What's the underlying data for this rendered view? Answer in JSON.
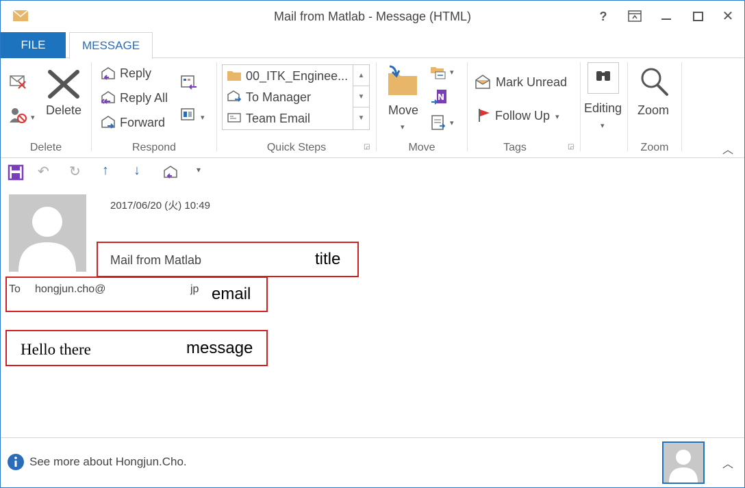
{
  "window": {
    "title": "Mail from Matlab - Message (HTML)"
  },
  "titlebar": {
    "help": "?",
    "close": "✕"
  },
  "tabs": {
    "file": "FILE",
    "message": "MESSAGE"
  },
  "ribbon": {
    "delete_group": {
      "label": "Delete",
      "delete_button": "Delete"
    },
    "respond_group": {
      "label": "Respond",
      "reply": "Reply",
      "reply_all": "Reply All",
      "forward": "Forward"
    },
    "quick_steps": {
      "label": "Quick Steps",
      "items": [
        "00_ITK_Enginee...",
        "To Manager",
        "Team Email"
      ]
    },
    "move_group": {
      "label": "Move",
      "move_button": "Move"
    },
    "tags_group": {
      "label": "Tags",
      "mark_unread": "Mark Unread",
      "follow_up": "Follow Up"
    },
    "editing": {
      "label": "Editing"
    },
    "zoom_group": {
      "label": "Zoom",
      "zoom_button": "Zoom"
    }
  },
  "message": {
    "date": "2017/06/20 (火) 10:49",
    "subject": "Mail from Matlab",
    "to_label": "To",
    "to_address": "hongjun.cho@",
    "to_suffix": "jp",
    "body": "Hello there"
  },
  "annotations": {
    "title": "title",
    "email": "email",
    "message": "message"
  },
  "footer": {
    "people_pane": "See more about Hongjun.Cho."
  },
  "colors": {
    "accent": "#1e73be",
    "highlight_box": "#d02020"
  }
}
